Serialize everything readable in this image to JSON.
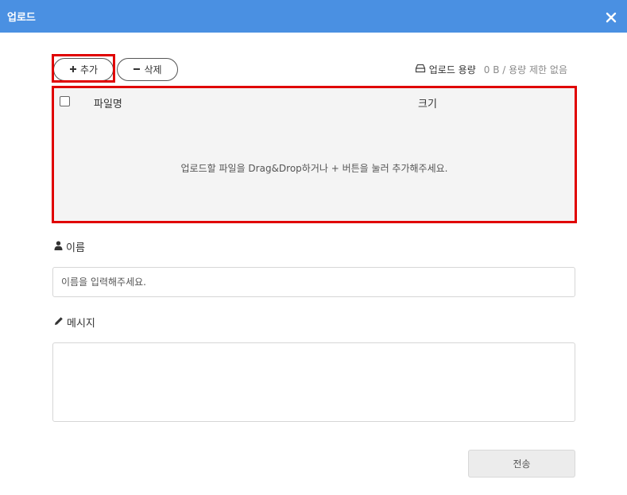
{
  "window": {
    "title": "업로드",
    "accent_color": "#4a90e2",
    "close_icon": "close-icon"
  },
  "toolbar": {
    "add_label": "추가",
    "delete_label": "삭제",
    "capacity_label": "업로드 용량",
    "capacity_value": "0 B / 용량 제한 없음"
  },
  "dropzone": {
    "columns": [
      "파일명",
      "크기"
    ],
    "hint": "업로드할 파일을 Drag&Drop하거나 + 버튼을 눌러 추가해주세요."
  },
  "form": {
    "name_label": "이름",
    "name_placeholder": "이름을 입력해주세요.",
    "name_value": "",
    "message_label": "메시지",
    "message_value": "",
    "submit_label": "전송"
  }
}
